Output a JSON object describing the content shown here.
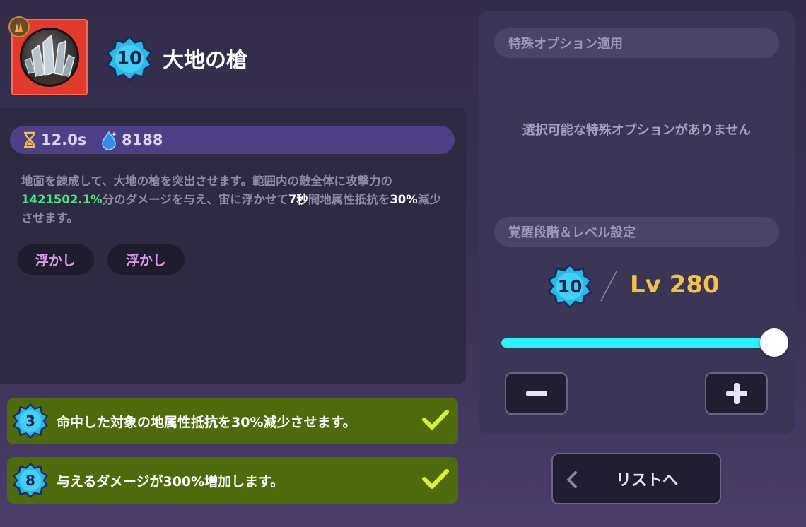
{
  "skill": {
    "name": "大地の槍",
    "awakening": "10",
    "icon": "earth-spear-crystal-icon",
    "cooldown": "12.0s",
    "mana_cost": "8188",
    "description_1": "地面を錬成して、大地の槍を突出させます。範囲内の敵全体に攻撃力の",
    "damage_percent": "1421502.1%",
    "description_2": "分のダメージを与え、宙に浮かせて",
    "duration": "7秒",
    "description_3": "間地属性抵抗を",
    "reduce_percent": "30%",
    "description_4": "減少させます。",
    "tags": [
      "浮かし",
      "浮かし"
    ]
  },
  "bonuses": [
    {
      "level": "3",
      "text": "命中した対象の地属性抵抗を30%減少させます。",
      "active": true
    },
    {
      "level": "8",
      "text": "与えるダメージが300%増加します。",
      "active": true
    }
  ],
  "special_options": {
    "header": "特殊オプション適用",
    "empty_message": "選択可能な特殊オプションがありません"
  },
  "level_settings": {
    "header": "覚醒段階＆レベル設定",
    "awakening": "10",
    "level_label": "Lv 280",
    "slider_fraction": 1.0
  },
  "back_button": {
    "label": "リストへ"
  },
  "colors": {
    "accent_cyan": "#2ef0ff",
    "level_gold": "#f2c14a",
    "bonus_green": "#4f6a0c",
    "damage_green": "#4fe08a",
    "tag_pink": "#d79be6"
  }
}
